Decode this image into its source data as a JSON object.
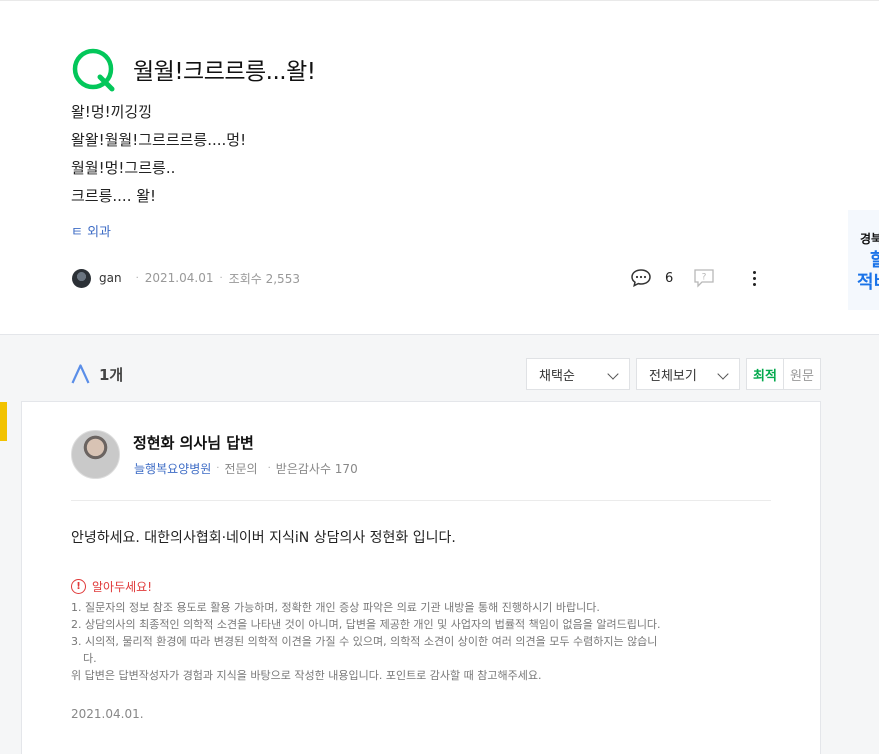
{
  "question": {
    "title": "월월!크르르릉...왈!",
    "body": [
      "왈!멍!끼깅낑",
      "왈왈!월월!그르르르릉....멍!",
      "월월!멍!그르릉..",
      "크르릉.... 왈!"
    ],
    "category": "ㅌ 외과",
    "author": "gan",
    "date": "2021.04.01",
    "views": "조회수 2,553",
    "comment_count": "6"
  },
  "ad": {
    "line1": "경북",
    "line2": "할",
    "line3": "적비"
  },
  "answers": {
    "count": "1개",
    "sort_label": "채택순",
    "view_label": "전체보기",
    "toggle_on": "최적",
    "toggle_off": "원문"
  },
  "answer": {
    "name": "정현화 의사님 답변",
    "hospital": "늘행복요양병원",
    "role": "전문의",
    "thanks": "받은감사수 170",
    "greeting": "안녕하세요. 대한의사협회·네이버 지식iN 상담의사 정현화 입니다.",
    "notice_title": "알아두세요!",
    "notice_items": [
      "1. 질문자의 정보 참조 용도로 활용 가능하며, 정확한 개인 증상 파악은 의료 기관 내방을 통해 진행하시기 바랍니다.",
      "2. 상담의사의 최종적인 의학적 소견을 나타낸 것이 아니며, 답변을 제공한 개인 및 사업자의 법률적 책임이 없음을 알려드립니다.",
      "3. 시의적, 물리적 환경에 따라 변경된 의학적 이견을 가질 수 있으며, 의학적 소견이 상이한 여러 의견을 모두 수렴하지는 않습니",
      "다.",
      "위 답변은 답변작성자가 경험과 지식을 바탕으로 작성한 내용입니다. 포인트로 감사할 때 참고해주세요."
    ],
    "date": "2021.04.01."
  },
  "colors": {
    "accent_green": "#03a94d",
    "link_blue": "#3f6dc6",
    "warn_red": "#e03a3a"
  }
}
